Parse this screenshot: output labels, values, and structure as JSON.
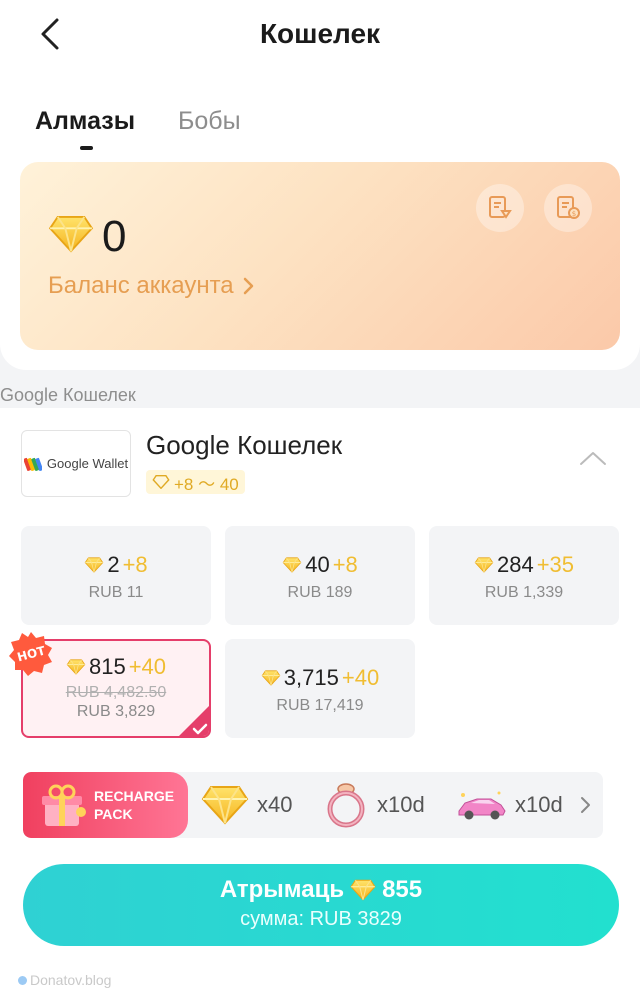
{
  "header": {
    "title": "Кошелек"
  },
  "tabs": [
    {
      "label": "Алмазы",
      "active": true
    },
    {
      "label": "Бобы",
      "active": false
    }
  ],
  "balance": {
    "value": "0",
    "link_label": "Баланс аккаунта"
  },
  "section_label": "Google Кошелек",
  "provider": {
    "name": "Google Кошелек",
    "logo_text": "Google Wallet",
    "bonus_range": "+8 〜 40"
  },
  "packages": [
    {
      "amount": "2",
      "bonus": "+8",
      "price": "RUB 11"
    },
    {
      "amount": "40",
      "bonus": "+8",
      "price": "RUB 189"
    },
    {
      "amount": "284",
      "bonus": "+35",
      "price": "RUB 1,339"
    },
    {
      "amount": "815",
      "bonus": "+40",
      "old_price": "RUB 4,482.50",
      "price": "RUB 3,829",
      "badge": "HOT",
      "selected": true
    },
    {
      "amount": "3,715",
      "bonus": "+40",
      "price": "RUB 17,419"
    }
  ],
  "recharge_pack": {
    "title_line1": "RECHARGE",
    "title_line2": "PACK",
    "rewards": [
      {
        "icon": "diamond-icon",
        "label": "x40"
      },
      {
        "icon": "ring-icon",
        "label": "x10d"
      },
      {
        "icon": "car-icon",
        "label": "x10d"
      }
    ]
  },
  "buy_button": {
    "label": "Атрымаць",
    "amount": "855",
    "sum": "сумма: RUB 3829"
  },
  "watermark": "Donatov.blog",
  "colors": {
    "accent_teal": "#2fd1d3",
    "gold": "#f0bd32",
    "orange_text": "#e69e52",
    "hot_red": "#e53e6a"
  }
}
